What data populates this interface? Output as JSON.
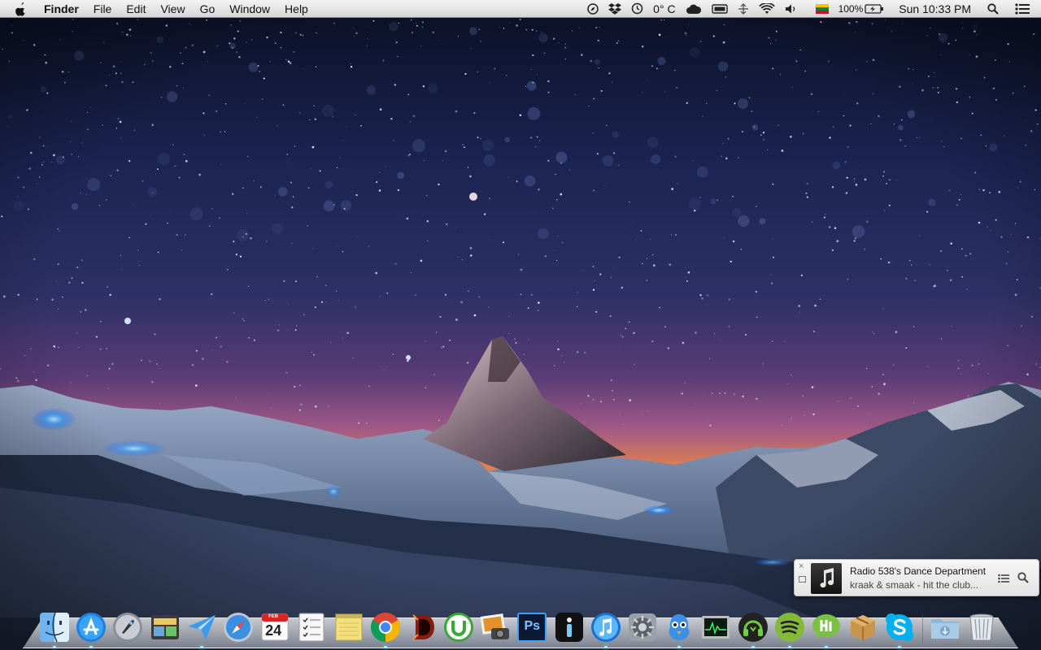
{
  "menubar": {
    "app_name": "Finder",
    "menus": [
      "File",
      "Edit",
      "View",
      "Go",
      "Window",
      "Help"
    ],
    "temperature": "0° C",
    "battery_percent": "100%",
    "clock": "Sun 10:33 PM"
  },
  "notification": {
    "title": "Radio 538's Dance Department",
    "subtitle": "kraak & smaak - hit the club...",
    "close_label": "×"
  },
  "dock": {
    "calendar_month": "FEB",
    "calendar_day": "24",
    "ps_label": "Ps",
    "items": [
      "finder-icon",
      "app-store-icon",
      "launchpad-icon",
      "photo-booth-icon",
      "sparrow-mail-icon",
      "safari-icon",
      "calendar-icon",
      "reminders-icon",
      "notes-icon",
      "chrome-icon",
      "diablo-icon",
      "utorrent-icon",
      "iphoto-icon",
      "photoshop-icon",
      "info-app-icon",
      "itunes-icon",
      "system-preferences-icon",
      "tweetbot-icon",
      "activity-monitor-icon",
      "headphones-app-icon",
      "spotify-icon",
      "messages-icon",
      "box-app-icon",
      "skype-icon",
      "downloads-folder-icon",
      "trash-icon"
    ]
  }
}
